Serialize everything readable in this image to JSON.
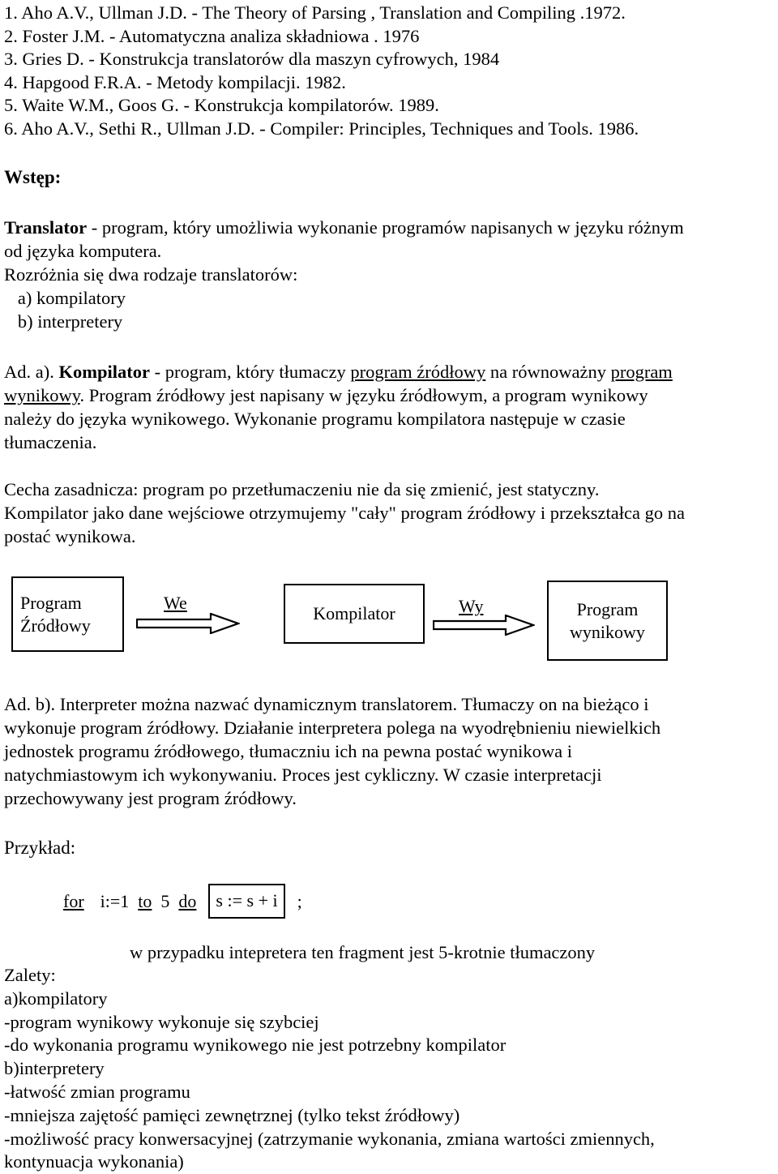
{
  "document": {
    "language": "pl",
    "references": [
      "1. Aho A.V., Ullman J.D. - The Theory of Parsing , Translation and Compiling .1972.",
      "2. Foster J.M. - Automatyczna analiza składniowa . 1976",
      "3. Gries D. - Konstrukcja translatorów dla maszyn cyfrowych, 1984",
      "4. Hapgood F.R.A. - Metody kompilacji. 1982.",
      "5. Waite W.M., Goos G. - Konstrukcja kompilatorów. 1989.",
      "6. Aho A.V., Sethi R., Ullman J.D. - Compiler: Principles, Techniques and Tools. 1986."
    ],
    "intro": {
      "heading": "Wstęp:",
      "translator_term": "Translator",
      "translator_line1_rest": " - program, który umożliwia wykonanie programów napisanych w języku różnym",
      "translator_line2": "od języka komputera.",
      "kinds_intro": "Rozróżnia się dwa rodzaje translatorów:",
      "kind_a": "   a) kompilatory",
      "kind_b": "   b) interpretery"
    },
    "ad_a": {
      "prefix": "Ad. a). ",
      "term": "Kompilator",
      "after_term": " - program, który tłumaczy ",
      "link1": "program źródłowy",
      "mid1": " na równoważny ",
      "link2a": "program",
      "link2b": "wynikowy",
      "line2_rest": ". Program źródłowy jest napisany w języku źródłowym, a program wynikowy",
      "line3": "należy do języka wynikowego. Wykonanie programu kompilatora następuje w czasie",
      "line4": "tłumaczenia."
    },
    "cecha": {
      "line1": "Cecha zasadnicza: program po przetłumaczeniu nie da się zmienić, jest statyczny.",
      "line2": "Kompilator jako dane wejściowe otrzymujemy \"cały\" program źródłowy i przekształca go na",
      "line3": "postać wynikowa."
    },
    "diagram": {
      "source_box_line1": "Program",
      "source_box_line2": "Źródłowy",
      "compiler_box": "Kompilator",
      "output_box_line1": "Program",
      "output_box_line2": "wynikowy",
      "arrow_in_label": "We",
      "arrow_out_label": "Wy"
    },
    "ad_b": {
      "line1": "Ad. b). Interpreter można nazwać dynamicznym translatorem. Tłumaczy on na bieżąco i",
      "line2": "wykonuje program źródłowy. Działanie interpretera polega na wyodrębnieniu niewielkich",
      "line3": "jednostek programu źródłowego, tłumaczniu ich na pewna postać wynikowa i",
      "line4": "natychmiastowym ich wykonywaniu. Proces jest cykliczny. W czasie interpretacji",
      "line5": "przechowywany jest program źródłowy."
    },
    "example": {
      "heading": "Przykład:",
      "kw_for": "for",
      "init": "i:=1",
      "kw_to": "to",
      "count": "5",
      "kw_do": "do",
      "body": "s := s + i",
      "semicolon": ";",
      "note": "w przypadku intepretera ten fragment jest 5-krotnie tłumaczony"
    },
    "advantages": {
      "heading": "Zalety:",
      "items": [
        "a)kompilatory",
        "-program wynikowy wykonuje się szybciej",
        "-do wykonania programu wynikowego nie jest potrzebny kompilator",
        "b)interpretery",
        "-łatwość zmian programu",
        "-mniejsza zajętość pamięci zewnętrznej (tylko tekst źródłowy)",
        "-możliwość pracy konwersacyjnej (zatrzymanie wykonania, zmiana wartości zmiennych,",
        "kontynuacja wykonania)"
      ]
    }
  }
}
